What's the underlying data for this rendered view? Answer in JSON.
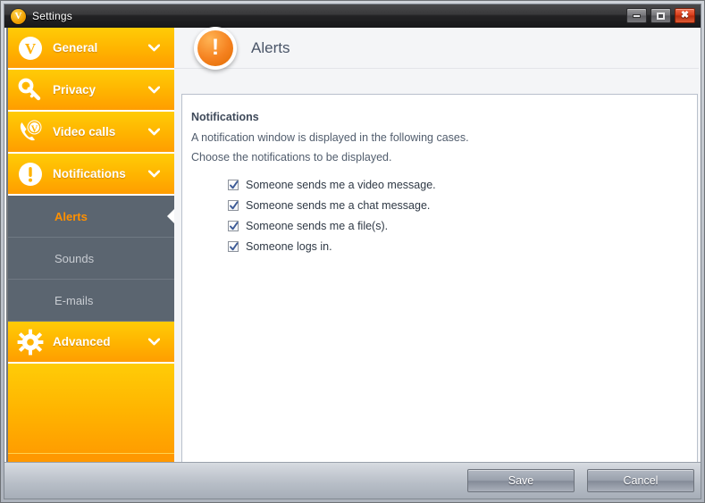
{
  "window": {
    "title": "Settings",
    "logo_icon": "v-logo-icon",
    "controls": {
      "minimize": "minimize-icon",
      "maximize": "maximize-icon",
      "close": "close-icon"
    }
  },
  "sidebar": {
    "groups": [
      {
        "label": "General",
        "icon": "v-circle-icon",
        "chevron": "chevron-down-icon"
      },
      {
        "label": "Privacy",
        "icon": "key-icon",
        "chevron": "chevron-down-icon"
      },
      {
        "label": "Video calls",
        "icon": "video-call-icon",
        "chevron": "chevron-down-icon"
      },
      {
        "label": "Notifications",
        "icon": "exclamation-circle-icon",
        "chevron": "chevron-down-icon"
      }
    ],
    "subitems": [
      {
        "label": "Alerts",
        "selected": true
      },
      {
        "label": "Sounds",
        "selected": false
      },
      {
        "label": "E-mails",
        "selected": false
      }
    ],
    "advanced": {
      "label": "Advanced",
      "icon": "gear-icon",
      "chevron": "chevron-down-icon"
    }
  },
  "header": {
    "title": "Alerts",
    "icon": "exclamation-circle-icon"
  },
  "main": {
    "section_title": "Notifications",
    "description_line1": "A notification window is displayed in the following cases.",
    "description_line2": "Choose the notifications to be displayed.",
    "checkboxes": [
      {
        "label": "Someone sends me a video message.",
        "checked": true
      },
      {
        "label": "Someone sends me a chat message.",
        "checked": true
      },
      {
        "label": "Someone sends me a file(s).",
        "checked": true
      },
      {
        "label": "Someone logs in.",
        "checked": true
      }
    ]
  },
  "footer": {
    "save_label": "Save",
    "cancel_label": "Cancel"
  },
  "colors": {
    "accent_orange": "#ff9800",
    "accent_yellow": "#ffcc07",
    "sidebar_sub_bg": "#5b6570",
    "selected_text": "#ff9000",
    "title_bar": "#232325"
  }
}
